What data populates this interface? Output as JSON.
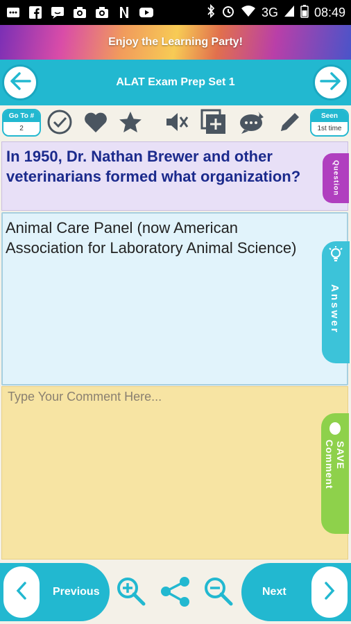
{
  "status_bar": {
    "time": "08:49",
    "network": "3G",
    "left_icons": [
      "message-icon",
      "facebook-icon",
      "chat-icon",
      "camera-icon",
      "camera-icon",
      "netflix-icon",
      "youtube-icon"
    ],
    "right_icons": [
      "bluetooth-icon",
      "alarm-icon",
      "wifi-icon",
      "signal-icon",
      "battery-icon"
    ]
  },
  "banner": {
    "text": "Enjoy the Learning Party!"
  },
  "header": {
    "title": "ALAT Exam Prep Set 1"
  },
  "toolbar": {
    "goto_label": "Go To #",
    "goto_value": "2",
    "seen_label": "Seen",
    "seen_value": "1st time",
    "icons": [
      "check-icon",
      "heart-icon",
      "star-icon",
      "mute-icon",
      "add-card-icon",
      "comment-edit-icon",
      "pencil-icon"
    ]
  },
  "question": {
    "text": "In 1950, Dr. Nathan Brewer and other veterinarians formed what organization?",
    "tab_label": "Question"
  },
  "answer": {
    "text": "Animal Care Panel (now American Association for Laboratory Animal Science)",
    "tab_label": "Answer"
  },
  "comment": {
    "placeholder": "Type Your Comment Here...",
    "tab_label_1": "SAVE",
    "tab_label_2": "Comment"
  },
  "bottom": {
    "previous_label": "Previous",
    "next_label": "Next"
  },
  "colors": {
    "accent": "#22b8d0",
    "question_bg": "#e8e0f7",
    "question_text": "#1b2a8c",
    "answer_bg": "#e1f3fb",
    "comment_bg": "#f7e4a3",
    "question_tab": "#b03fbf",
    "save_tab": "#8ed14b"
  }
}
